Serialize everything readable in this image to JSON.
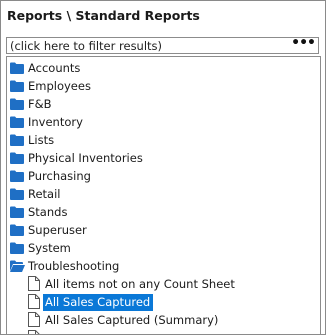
{
  "header": {
    "title": "Reports \\ Standard Reports"
  },
  "filter": {
    "text": "(click here to filter results)",
    "more_label": "•••"
  },
  "tree": {
    "folders": [
      {
        "label": "Accounts",
        "icon": "folder-icon"
      },
      {
        "label": "Employees",
        "icon": "folder-icon"
      },
      {
        "label": "F&B",
        "icon": "folder-icon"
      },
      {
        "label": "Inventory",
        "icon": "folder-icon"
      },
      {
        "label": "Lists",
        "icon": "folder-icon"
      },
      {
        "label": "Physical Inventories",
        "icon": "folder-icon"
      },
      {
        "label": "Purchasing",
        "icon": "folder-icon"
      },
      {
        "label": "Retail",
        "icon": "folder-icon"
      },
      {
        "label": "Stands",
        "icon": "folder-icon"
      },
      {
        "label": "Superuser",
        "icon": "folder-icon"
      },
      {
        "label": "System",
        "icon": "folder-icon"
      },
      {
        "label": "Troubleshooting",
        "icon": "folder-open-icon",
        "expanded": true
      }
    ],
    "reports": [
      {
        "label": "All items not on any Count Sheet",
        "icon": "document-icon"
      },
      {
        "label": "All Sales Captured",
        "icon": "document-icon",
        "selected": true
      },
      {
        "label": "All Sales Captured (Summary)",
        "icon": "document-icon"
      }
    ]
  },
  "colors": {
    "folder": "#1f6fc5",
    "selection": "#0a78d7"
  }
}
